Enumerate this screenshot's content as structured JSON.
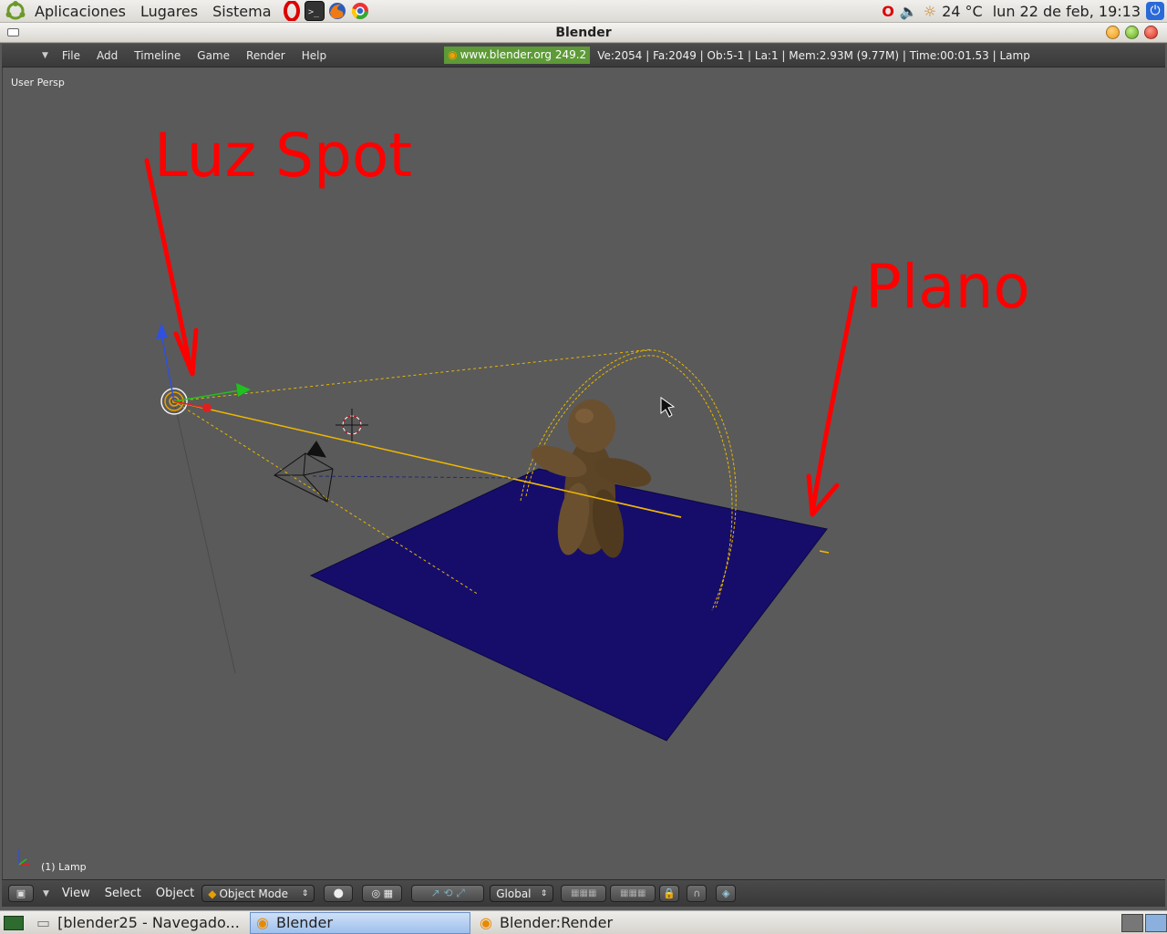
{
  "top_panel": {
    "menus": [
      "Aplicaciones",
      "Lugares",
      "Sistema"
    ],
    "temperature": "24 °C",
    "datetime": "lun 22 de feb, 19:13"
  },
  "window": {
    "title": "Blender"
  },
  "blender_header": {
    "menus": [
      "File",
      "Add",
      "Timeline",
      "Game",
      "Render",
      "Help"
    ],
    "site": "www.blender.org 249.2",
    "stats": "Ve:2054 | Fa:2049 | Ob:5-1 | La:1  | Mem:2.93M (9.77M)  | Time:00:01.53 | Lamp"
  },
  "viewport": {
    "persp": "User Persp",
    "object": "(1) Lamp",
    "annotations": {
      "spot": "Luz Spot",
      "plane": "Plano"
    }
  },
  "footer": {
    "view": "View",
    "select": "Select",
    "object": "Object",
    "mode": "Object Mode",
    "orientation": "Global"
  },
  "taskbar": {
    "tasks": [
      "[blender25 - Navegado...",
      "Blender",
      "Blender:Render"
    ]
  },
  "colors": {
    "plane": "#160d6b",
    "annotation": "#ff0000",
    "lamp_line": "#f0b800"
  }
}
